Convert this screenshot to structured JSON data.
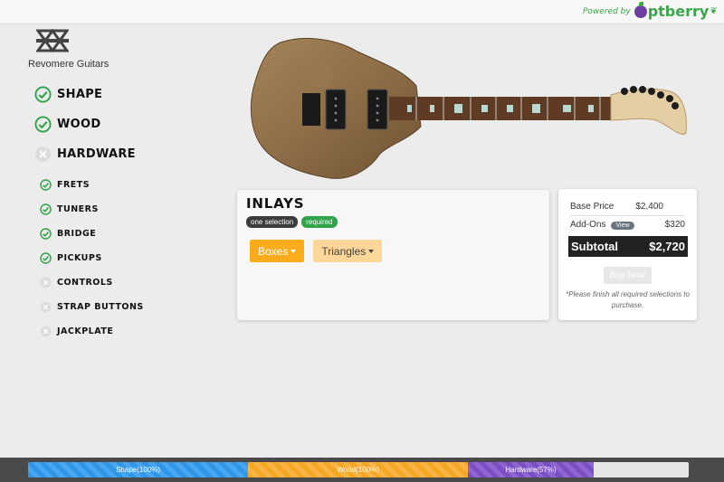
{
  "topbar": {
    "powered_by": "Powered by",
    "brand": "ptberry"
  },
  "company": {
    "name": "Revomere Guitars"
  },
  "nav": {
    "steps": [
      {
        "label": "Shape",
        "status": "done"
      },
      {
        "label": "Wood",
        "status": "done"
      },
      {
        "label": "Hardware",
        "status": "incomplete"
      }
    ],
    "substeps": [
      {
        "label": "Frets",
        "status": "done"
      },
      {
        "label": "Tuners",
        "status": "done"
      },
      {
        "label": "Bridge",
        "status": "done"
      },
      {
        "label": "Pickups",
        "status": "done"
      },
      {
        "label": "Controls",
        "status": "incomplete"
      },
      {
        "label": "Strap Buttons",
        "status": "incomplete"
      },
      {
        "label": "Jackplate",
        "status": "incomplete"
      }
    ]
  },
  "inlays": {
    "title": "Inlays",
    "badge_selection": "one selection",
    "badge_required": "required",
    "options": [
      {
        "label": "Boxes",
        "selected": true
      },
      {
        "label": "Triangles",
        "selected": false
      }
    ]
  },
  "pricing": {
    "base_label": "Base Price",
    "base_value": "$2,400",
    "addons_label": "Add-Ons",
    "view_label": "View",
    "addons_value": "$320",
    "subtotal_label": "Subtotal",
    "subtotal_value": "$2,720",
    "buy_label": "Buy Now",
    "note": "*Please finish all required selections to purchase."
  },
  "progress": {
    "segments": [
      {
        "label": "Shape(100%)",
        "fraction": 0.333,
        "color": "#2f96e8"
      },
      {
        "label": "Wood(100%)",
        "fraction": 0.333,
        "color": "#f5a623"
      },
      {
        "label": "Hardware(57%)",
        "fraction": 0.19,
        "color": "#7b4fc4"
      }
    ]
  },
  "colors": {
    "accent": "#2fa44a",
    "option_active": "#fbac1c",
    "option_inactive": "#fdd79a"
  }
}
